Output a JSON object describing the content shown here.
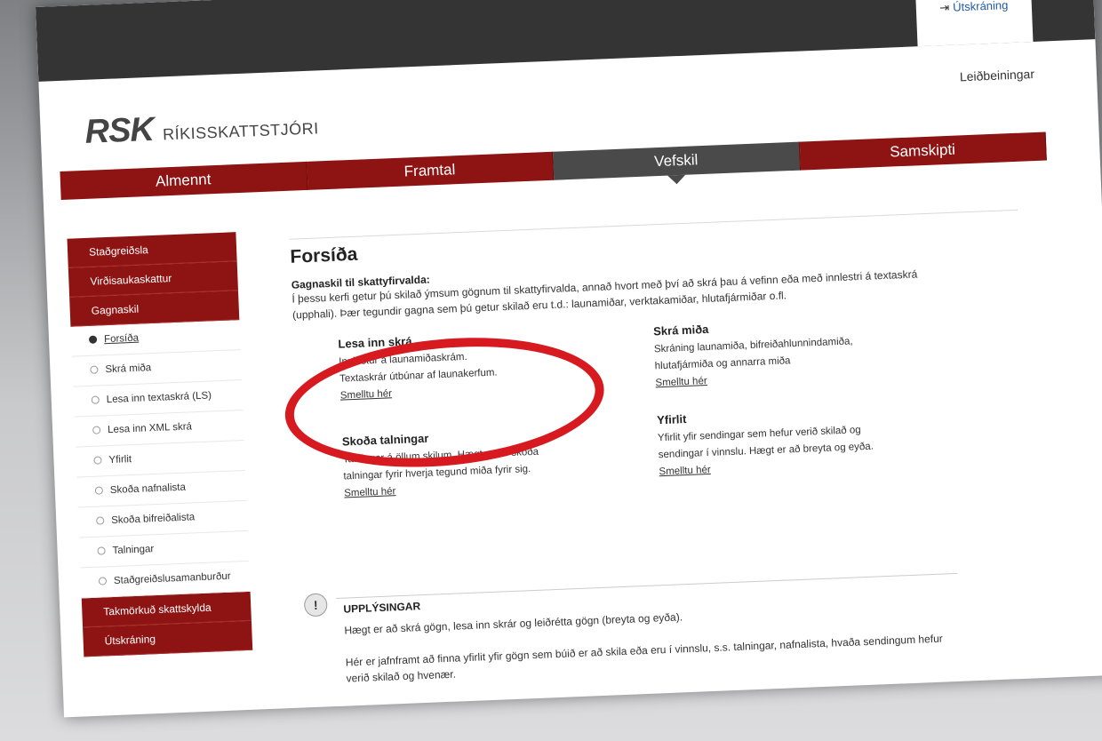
{
  "header": {
    "logout_label": "Útskráning",
    "logout_icon": "sign-out-icon",
    "help_label": "Leiðbeiningar",
    "logo_mark": "RSK",
    "logo_org": "RÍKISSKATTSTJÓRI"
  },
  "main_nav": [
    {
      "label": "Almennt",
      "active": false
    },
    {
      "label": "Framtal",
      "active": false
    },
    {
      "label": "Vefskil",
      "active": true
    },
    {
      "label": "Samskipti",
      "active": false
    }
  ],
  "sidebar": {
    "top_sections": [
      "Staðgreiðsla",
      "Virðisaukaskattur",
      "Gagnaskil"
    ],
    "sub_items": [
      {
        "label": "Forsíða",
        "active": true
      },
      {
        "label": "Skrá miða",
        "active": false
      },
      {
        "label": "Lesa inn textaskrá (LS)",
        "active": false
      },
      {
        "label": "Lesa inn XML skrá",
        "active": false
      },
      {
        "label": "Yfirlit",
        "active": false
      },
      {
        "label": "Skoða nafnalista",
        "active": false
      },
      {
        "label": "Skoða bifreiðalista",
        "active": false
      },
      {
        "label": "Talningar",
        "active": false
      },
      {
        "label": "Staðgreiðslusamanburður",
        "active": false
      }
    ],
    "bottom_sections": [
      "Takmörkuð skattskylda",
      "Útskráning"
    ]
  },
  "content": {
    "title": "Forsíða",
    "intro_heading": "Gagnaskil til skattyfirvalda:",
    "intro_text": "Í þessu kerfi getur þú skilað ýmsum gögnum til skattyfirvalda, annað hvort með því að skrá þau á vefinn eða með innlestri á textaskrá (upphali). Þær tegundir gagna sem þú getur skilað eru t.d.: launamiðar, verktakamiðar, hlutafjármiðar o.fl.",
    "cards": {
      "lesa": {
        "title": "Lesa inn skrá",
        "line1": "Innlestur á launamiðaskrám.",
        "line2": "Textaskrár útbúnar af launakerfum.",
        "link": "Smelltu hér"
      },
      "skra": {
        "title": "Skrá miða",
        "line1": "Skráning launamiða, bifreiðahlunnindamiða,",
        "line2": "hlutafjármiða og annarra miða",
        "link": "Smelltu hér"
      },
      "talningar": {
        "title": "Skoða talningar",
        "line1": "Talningar á öllum skilum.  Hægt er að skoða",
        "line2": "talningar fyrir hverja tegund miða fyrir sig.",
        "link": "Smelltu hér"
      },
      "yfirlit": {
        "title": "Yfirlit",
        "line1": "Yfirlit yfir sendingar sem hefur verið skilað og",
        "line2": "sendingar í vinnslu.  Hægt er að breyta og eyða.",
        "link": "Smelltu hér"
      }
    },
    "info": {
      "icon": "exclamation-icon",
      "title": "UPPLÝSINGAR",
      "para1": "Hægt er að skrá gögn, lesa inn skrár og leiðrétta gögn (breyta og eyða).",
      "para2": "Hér er jafnframt að finna yfirlit yfir gögn sem búið er að skila eða eru í vinnslu, s.s. talningar, nafnalista, hvaða sendingum hefur verið skilað og hvenær."
    }
  },
  "colors": {
    "brand_red": "#8e1414",
    "active_nav": "#4a4a4a",
    "annotation_red": "#d71920"
  }
}
